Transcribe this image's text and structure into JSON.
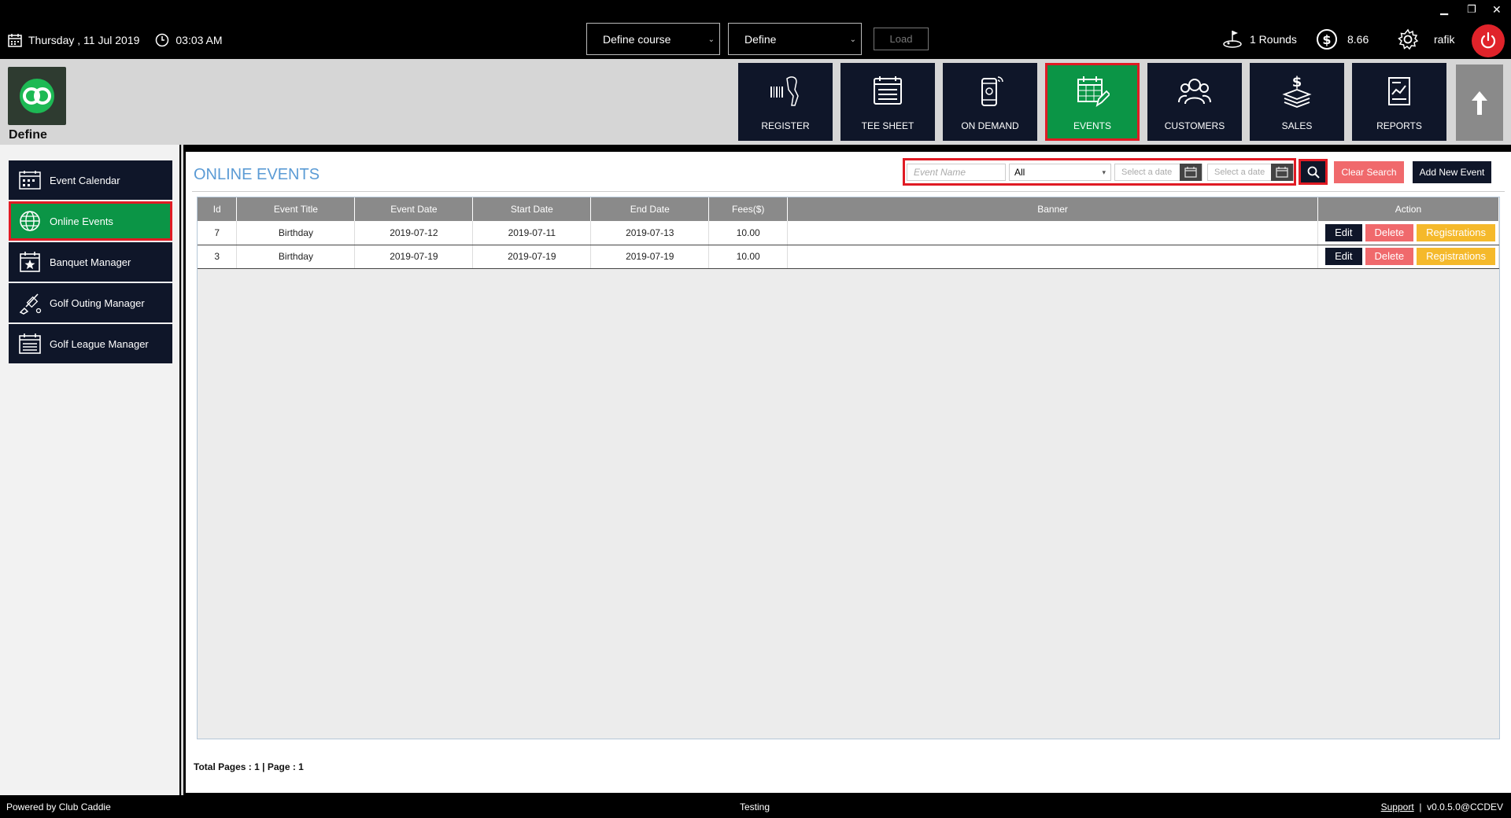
{
  "topbar": {
    "day": "Thursday ,",
    "date": "11 Jul 2019",
    "time": "03:03 AM",
    "course_select": "Define course",
    "define_select": "Define",
    "load_label": "Load",
    "rounds": "1 Rounds",
    "balance": "8.66",
    "user": "rafik"
  },
  "brand": {
    "label": "Define"
  },
  "nav": [
    {
      "label": "REGISTER",
      "icon": "barcode-scanner-icon"
    },
    {
      "label": "TEE SHEET",
      "icon": "tee-sheet-icon"
    },
    {
      "label": "ON DEMAND",
      "icon": "phone-icon"
    },
    {
      "label": "EVENTS",
      "icon": "calendar-edit-icon",
      "active": true
    },
    {
      "label": "CUSTOMERS",
      "icon": "users-icon"
    },
    {
      "label": "SALES",
      "icon": "money-icon"
    },
    {
      "label": "REPORTS",
      "icon": "report-icon"
    }
  ],
  "sidebar": {
    "items": [
      {
        "label": "Event Calendar",
        "icon": "calendar-icon"
      },
      {
        "label": "Online Events",
        "icon": "globe-icon",
        "active": true
      },
      {
        "label": "Banquet Manager",
        "icon": "star-calendar-icon"
      },
      {
        "label": "Golf Outing Manager",
        "icon": "golf-club-icon"
      },
      {
        "label": "Golf League Manager",
        "icon": "list-calendar-icon"
      }
    ]
  },
  "main": {
    "title": "ONLINE EVENTS",
    "filters": {
      "event_name_placeholder": "Event Name",
      "status_value": "All",
      "date_from_placeholder": "Select a date",
      "date_to_placeholder": "Select a date"
    },
    "clear_label": "Clear Search",
    "add_label": "Add New Event",
    "table": {
      "headers": [
        "Id",
        "Event Title",
        "Event Date",
        "Start Date",
        "End Date",
        "Fees($)",
        "Banner",
        "Action"
      ],
      "rows": [
        {
          "id": "7",
          "title": "Birthday",
          "event_date": "2019-07-12",
          "start": "2019-07-11",
          "end": "2019-07-13",
          "fees": "10.00",
          "banner": ""
        },
        {
          "id": "3",
          "title": "Birthday",
          "event_date": "2019-07-19",
          "start": "2019-07-19",
          "end": "2019-07-19",
          "fees": "10.00",
          "banner": ""
        }
      ],
      "edit_label": "Edit",
      "delete_label": "Delete",
      "registrations_label": "Registrations"
    },
    "pageinfo": "Total Pages : 1 | Page : 1"
  },
  "footer": {
    "left": "Powered by Club Caddie",
    "center": "Testing",
    "support": "Support",
    "version": "v0.0.5.0@CCDEV"
  },
  "colors": {
    "navy": "#0f1629",
    "green": "#0b9546",
    "red": "#e01b24",
    "blue_title": "#5b9bd5",
    "orange": "#f5b92b",
    "salmon": "#f0696c"
  }
}
